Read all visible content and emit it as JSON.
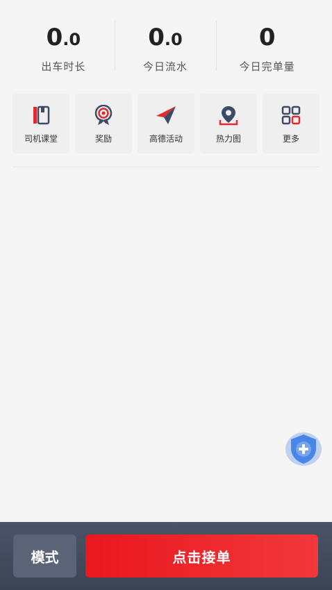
{
  "stats": [
    {
      "int": "0",
      "dec": ".0",
      "label": "出车时长"
    },
    {
      "int": "0",
      "dec": ".0",
      "label": "今日流水"
    },
    {
      "int": "0",
      "dec": "",
      "label": "今日完单量"
    }
  ],
  "features": [
    {
      "label": "司机课堂",
      "icon": "book-icon"
    },
    {
      "label": "奖励",
      "icon": "medal-icon"
    },
    {
      "label": "高德活动",
      "icon": "paper-plane-icon"
    },
    {
      "label": "热力图",
      "icon": "location-pin-icon"
    },
    {
      "label": "更多",
      "icon": "grid-icon"
    }
  ],
  "floating": {
    "icon": "shield-plus-icon"
  },
  "bottom": {
    "mode_label": "模式",
    "accept_label": "点击接单"
  },
  "colors": {
    "accent_red": "#e8181d",
    "icon_navy": "#3c4a66",
    "bottom_bar": "#434c5e",
    "shield_blue": "#4a86e8"
  }
}
